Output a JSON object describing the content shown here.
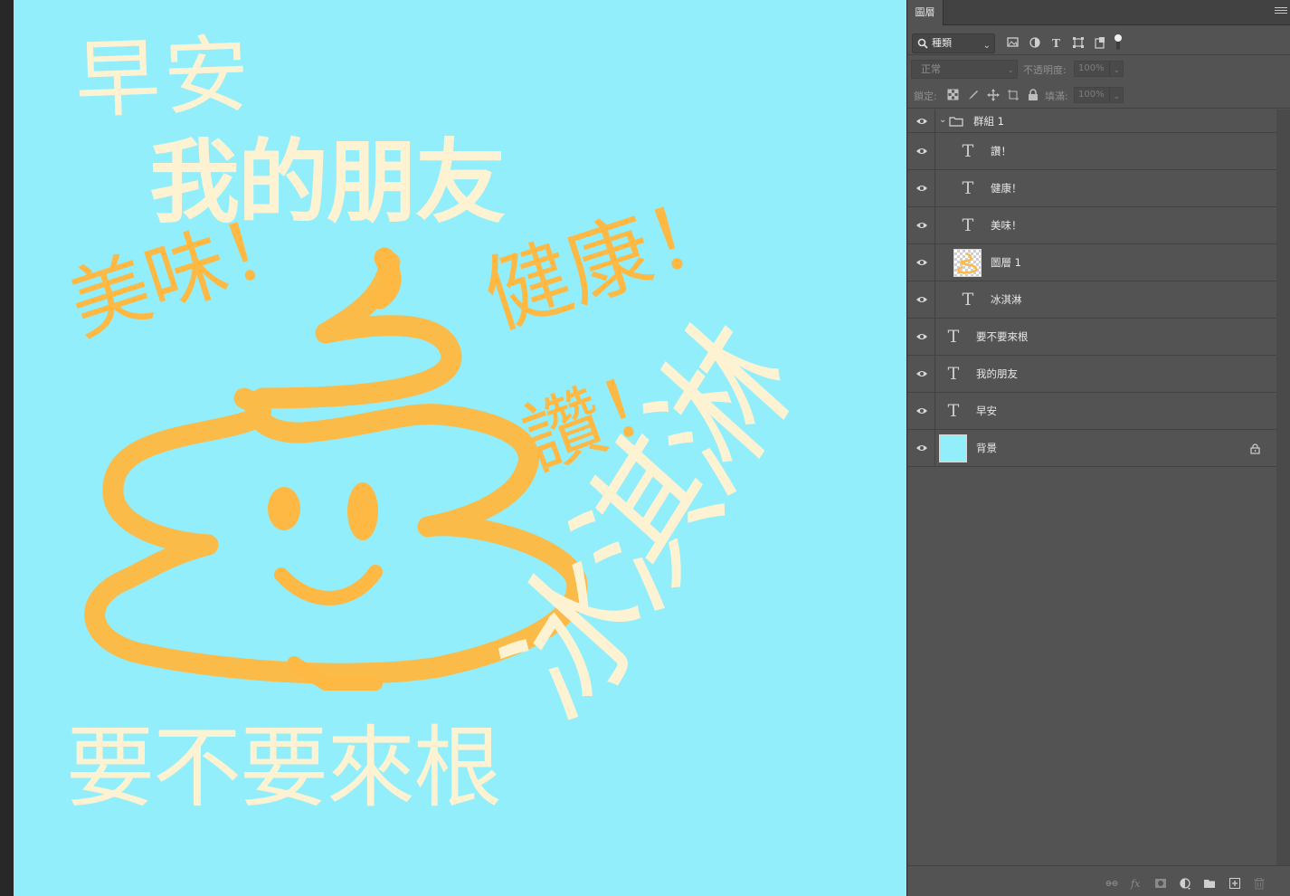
{
  "canvas": {
    "background_color": "#93eefc",
    "text_color": "#fdf3d2",
    "accent_color": "#fdb943",
    "texts": {
      "morning": "早安",
      "friend": "我的朋友",
      "tasty": "美味！",
      "healthy": "健康！",
      "praise": "讚！",
      "want_one": "要不要來根",
      "icecream": "冰淇淋"
    }
  },
  "panel": {
    "tab_title": "圖層",
    "filter": {
      "selected": "種類"
    },
    "blend_mode": "正常",
    "opacity_label": "不透明度:",
    "opacity_value": "100%",
    "lock_label": "鎖定:",
    "fill_label": "填滿:",
    "fill_value": "100%",
    "layers": [
      {
        "name": "群組 1",
        "kind": "group",
        "visible": true
      },
      {
        "name": "讚！",
        "kind": "text",
        "visible": true
      },
      {
        "name": "健康！",
        "kind": "text",
        "visible": true
      },
      {
        "name": "美味！",
        "kind": "text",
        "visible": true
      },
      {
        "name": "圖層 1",
        "kind": "pixel",
        "visible": true
      },
      {
        "name": "冰淇淋",
        "kind": "text",
        "visible": true
      },
      {
        "name": "要不要來根",
        "kind": "text",
        "visible": true
      },
      {
        "name": "我的朋友",
        "kind": "text",
        "visible": true
      },
      {
        "name": "早安",
        "kind": "text",
        "visible": true
      },
      {
        "name": "背景",
        "kind": "background",
        "visible": true,
        "locked": true
      }
    ],
    "bottom_icons": [
      "link-layers-icon",
      "fx-icon",
      "add-mask-icon",
      "adjustment-layer-icon",
      "new-group-icon",
      "new-layer-icon",
      "delete-icon"
    ]
  }
}
